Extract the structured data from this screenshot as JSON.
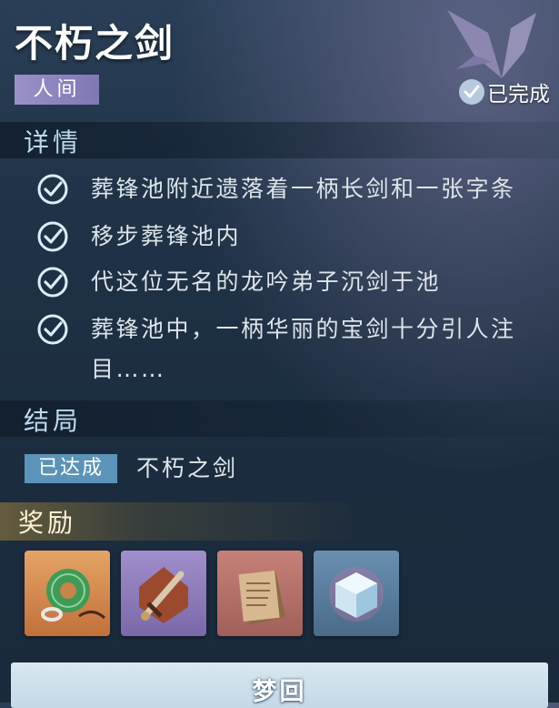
{
  "quest": {
    "title": "不朽之剑",
    "realm": "人间",
    "status": "已完成"
  },
  "details": {
    "heading": "详情",
    "steps": [
      {
        "text": "葬锋池附近遗落着一柄长剑和一张字条",
        "done": true
      },
      {
        "text": "移步葬锋池内",
        "done": true
      },
      {
        "text": "代这位无名的龙吟弟子沉剑于池",
        "done": true
      },
      {
        "text": "葬锋池中，一柄华丽的宝剑十分引人注目……",
        "done": true
      }
    ]
  },
  "ending": {
    "heading": "结局",
    "badge": "已达成",
    "name": "不朽之剑"
  },
  "rewards": {
    "heading": "奖励",
    "items": [
      {
        "icon": "jade-pendant-icon",
        "rarity_color": "#d68a4a"
      },
      {
        "icon": "dagger-icon",
        "rarity_color": "#8e7ab8"
      },
      {
        "icon": "document-icon",
        "rarity_color": "#b8716a"
      },
      {
        "icon": "ice-cube-icon",
        "rarity_color": "#5a7d9c"
      }
    ]
  },
  "action": {
    "label": "梦回"
  },
  "colors": {
    "realm_tag": "#9a91c8",
    "ending_badge": "#5c93b8",
    "check": "#d9eef8"
  }
}
